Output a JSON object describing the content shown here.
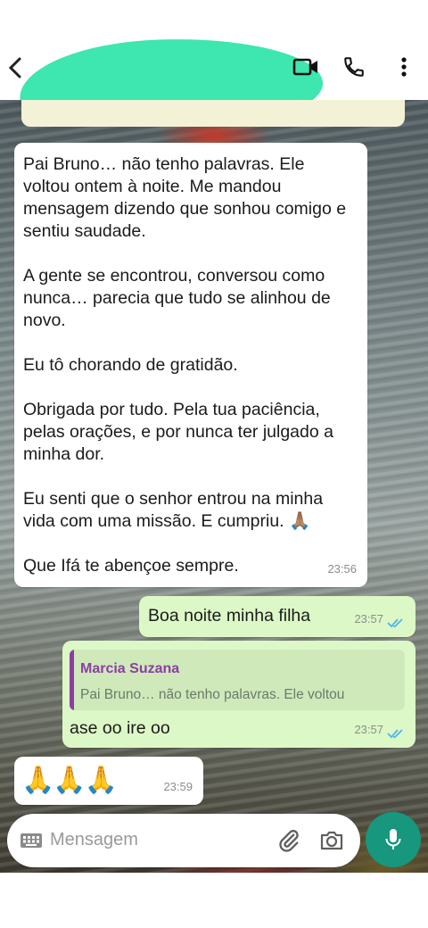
{
  "chat": {
    "messages": [
      {
        "direction": "incoming",
        "paragraphs": [
          "Pai Bruno… não tenho palavras. Ele voltou ontem à noite. Me mandou mensagem dizendo que sonhou comigo e sentiu saudade.",
          "A gente se encontrou, conversou como nunca… parecia que tudo se alinhou de novo.",
          "Eu tô chorando de gratidão.",
          "Obrigada por tudo. Pela tua paciência, pelas orações, e por nunca ter julgado a minha dor.",
          "Eu senti que o senhor entrou na minha vida com uma missão. E cumpriu. 🙏🏽",
          "Que Ifá te abençoe sempre."
        ],
        "time": "23:56"
      },
      {
        "direction": "outgoing",
        "text": "Boa noite minha filha",
        "time": "23:57",
        "status": "read"
      },
      {
        "direction": "outgoing",
        "quote": {
          "author": "Marcia Suzana",
          "text": "Pai Bruno… não tenho palavras. Ele voltou"
        },
        "text": "ase oo ire oo",
        "time": "23:57",
        "status": "read"
      },
      {
        "direction": "incoming",
        "text": "🙏🙏🙏",
        "time": "23:59"
      }
    ]
  },
  "input": {
    "placeholder": "Mensagem"
  },
  "icons": {
    "back": "arrow-left-icon",
    "video": "video-call-icon",
    "phone": "phone-icon",
    "menu": "more-vert-icon",
    "keyboard": "keyboard-icon",
    "attach": "paperclip-icon",
    "camera": "camera-icon",
    "mic": "microphone-icon"
  },
  "colors": {
    "incoming_bubble": "#ffffff",
    "outgoing_bubble": "#dcf8c6",
    "read_ticks": "#4fb6ec",
    "quote_author": "#8b3fa3",
    "mic_button": "#16977e",
    "redaction": "#3ee6b0"
  }
}
